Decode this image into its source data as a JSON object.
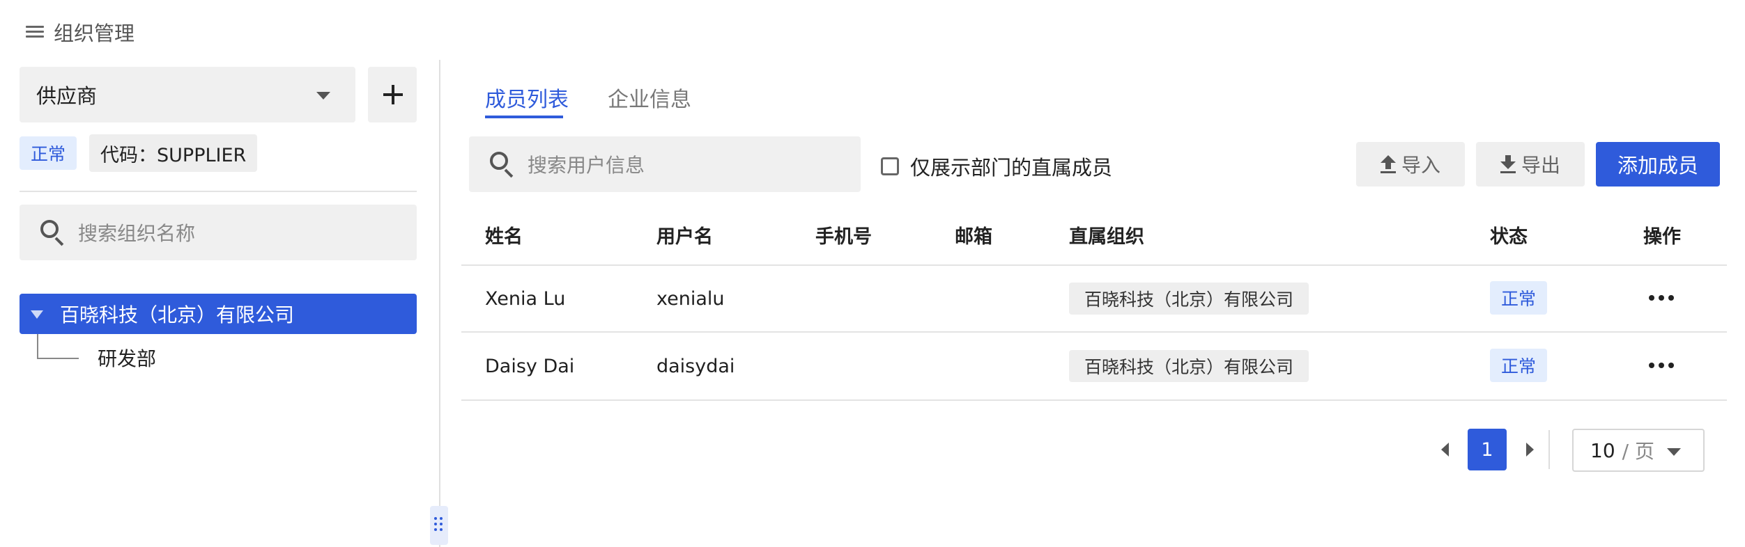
{
  "header": {
    "title": "组织管理",
    "menu_icon": "menu-icon"
  },
  "left_panel": {
    "org_select": {
      "value": "供应商"
    },
    "add_button_icon": "plus-icon",
    "status_tag": "正常",
    "code_tag": "代码：SUPPLIER",
    "search": {
      "placeholder": "搜索组织名称"
    },
    "tree": {
      "root": {
        "label": "百晓科技（北京）有限公司",
        "expanded": true
      },
      "children": [
        {
          "label": "研发部"
        }
      ]
    }
  },
  "tabs": [
    {
      "label": "成员列表",
      "active": true
    },
    {
      "label": "企业信息",
      "active": false
    }
  ],
  "toolbar": {
    "search_placeholder": "搜索用户信息",
    "checkbox_label": "仅展示部门的直属成员",
    "checkbox_checked": false,
    "import_label": "导入",
    "export_label": "导出",
    "add_member_label": "添加成员"
  },
  "table": {
    "columns": [
      "姓名",
      "用户名",
      "手机号",
      "邮箱",
      "直属组织",
      "状态",
      "操作"
    ],
    "rows": [
      {
        "name": "Xenia Lu",
        "username": "xenialu",
        "phone": "",
        "email": "",
        "org": "百晓科技（北京）有限公司",
        "status": "正常"
      },
      {
        "name": "Daisy Dai",
        "username": "daisydai",
        "phone": "",
        "email": "",
        "org": "百晓科技（北京）有限公司",
        "status": "正常"
      }
    ]
  },
  "pagination": {
    "current_page": "1",
    "page_size": "10",
    "page_size_unit": "/ 页"
  },
  "colors": {
    "primary": "#2f5bdb",
    "status_bg": "#e3edfd"
  }
}
